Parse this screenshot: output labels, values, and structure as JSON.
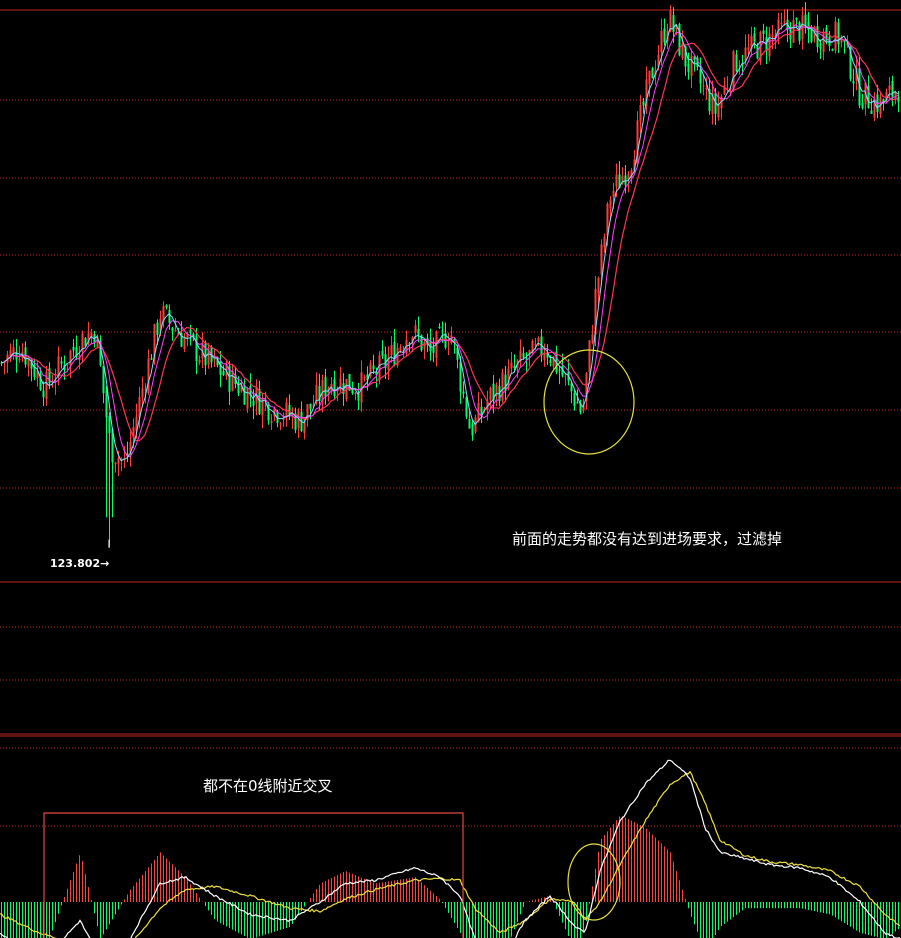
{
  "annotations": {
    "main_note": "前面的走势都没有达到进场要求，过滤掉",
    "macd_note": "都不在0线附近交叉"
  },
  "low_marker": {
    "label": "123.802→",
    "value": 123.802
  },
  "colors": {
    "background": "#000000",
    "grid": "#c0281e",
    "candle_up": "#ff3b3b",
    "candle_down": "#00ff66",
    "ma_fast": "#ffffff",
    "ma_mid": "#ff40ff",
    "ma_slow": "#ff3355",
    "ma_light": "#80e0ff",
    "circle": "#e6e040",
    "box": "#e04a4a",
    "macd_dif": "#ffffff",
    "macd_dea": "#f0e040",
    "hist_pos": "#ff4040",
    "hist_neg": "#00ff66"
  },
  "chart_data": [
    {
      "type": "candlestick",
      "title": "",
      "ylim": [
        123.7,
        125.4
      ],
      "grid": true,
      "price_path": [
        [
          0,
          124.35
        ],
        [
          20,
          124.4
        ],
        [
          45,
          124.28
        ],
        [
          80,
          124.42
        ],
        [
          95,
          124.45
        ],
        [
          110,
          124.1
        ],
        [
          125,
          124.05
        ],
        [
          140,
          124.25
        ],
        [
          160,
          124.5
        ],
        [
          185,
          124.42
        ],
        [
          210,
          124.35
        ],
        [
          240,
          124.28
        ],
        [
          270,
          124.22
        ],
        [
          300,
          124.18
        ],
        [
          330,
          124.3
        ],
        [
          360,
          124.28
        ],
        [
          385,
          124.35
        ],
        [
          410,
          124.45
        ],
        [
          430,
          124.38
        ],
        [
          450,
          124.45
        ],
        [
          470,
          124.15
        ],
        [
          490,
          124.25
        ],
        [
          520,
          124.35
        ],
        [
          545,
          124.4
        ],
        [
          565,
          124.3
        ],
        [
          582,
          124.2
        ],
        [
          595,
          124.55
        ],
        [
          610,
          124.85
        ],
        [
          630,
          124.95
        ],
        [
          650,
          125.2
        ],
        [
          668,
          125.38
        ],
        [
          685,
          125.25
        ],
        [
          700,
          125.18
        ],
        [
          715,
          125.1
        ],
        [
          735,
          125.25
        ],
        [
          760,
          125.3
        ],
        [
          790,
          125.35
        ],
        [
          815,
          125.33
        ],
        [
          840,
          125.32
        ],
        [
          860,
          125.15
        ],
        [
          880,
          125.12
        ],
        [
          901,
          125.18
        ]
      ],
      "low_value": 123.802,
      "moving_averages": [
        "fast",
        "mid",
        "slow"
      ]
    },
    {
      "type": "macd",
      "title": "",
      "zero_line": 0,
      "dif_path": [
        [
          0,
          -0.5
        ],
        [
          40,
          -1.0
        ],
        [
          80,
          -0.3
        ],
        [
          100,
          -0.9
        ],
        [
          130,
          -0.6
        ],
        [
          160,
          0.3
        ],
        [
          185,
          0.4
        ],
        [
          215,
          0.1
        ],
        [
          250,
          -0.2
        ],
        [
          290,
          -0.3
        ],
        [
          320,
          0.0
        ],
        [
          345,
          0.3
        ],
        [
          375,
          0.35
        ],
        [
          415,
          0.55
        ],
        [
          440,
          0.4
        ],
        [
          460,
          0.1
        ],
        [
          475,
          -0.6
        ],
        [
          500,
          -1.0
        ],
        [
          525,
          -0.3
        ],
        [
          550,
          0.1
        ],
        [
          575,
          -0.4
        ],
        [
          585,
          -0.5
        ],
        [
          600,
          0.5
        ],
        [
          620,
          1.3
        ],
        [
          645,
          1.9
        ],
        [
          670,
          2.3
        ],
        [
          690,
          2.0
        ],
        [
          705,
          1.2
        ],
        [
          720,
          0.8
        ],
        [
          745,
          0.7
        ],
        [
          770,
          0.6
        ],
        [
          800,
          0.55
        ],
        [
          830,
          0.4
        ],
        [
          860,
          0.0
        ],
        [
          885,
          -0.5
        ],
        [
          901,
          -0.6
        ]
      ],
      "dea_path": [
        [
          0,
          -0.2
        ],
        [
          40,
          -0.5
        ],
        [
          80,
          -0.7
        ],
        [
          100,
          -0.6
        ],
        [
          130,
          -0.7
        ],
        [
          160,
          -0.1
        ],
        [
          185,
          0.2
        ],
        [
          215,
          0.25
        ],
        [
          250,
          0.1
        ],
        [
          290,
          -0.1
        ],
        [
          320,
          -0.15
        ],
        [
          345,
          0.05
        ],
        [
          375,
          0.2
        ],
        [
          415,
          0.35
        ],
        [
          440,
          0.38
        ],
        [
          460,
          0.35
        ],
        [
          475,
          -0.1
        ],
        [
          500,
          -0.5
        ],
        [
          525,
          -0.3
        ],
        [
          550,
          0.05
        ],
        [
          575,
          0.0
        ],
        [
          585,
          -0.3
        ],
        [
          600,
          0.0
        ],
        [
          620,
          0.6
        ],
        [
          645,
          1.3
        ],
        [
          670,
          1.9
        ],
        [
          690,
          2.1
        ],
        [
          705,
          1.6
        ],
        [
          720,
          1.0
        ],
        [
          745,
          0.75
        ],
        [
          770,
          0.65
        ],
        [
          800,
          0.6
        ],
        [
          830,
          0.5
        ],
        [
          860,
          0.25
        ],
        [
          885,
          -0.2
        ],
        [
          901,
          -0.4
        ]
      ]
    }
  ]
}
